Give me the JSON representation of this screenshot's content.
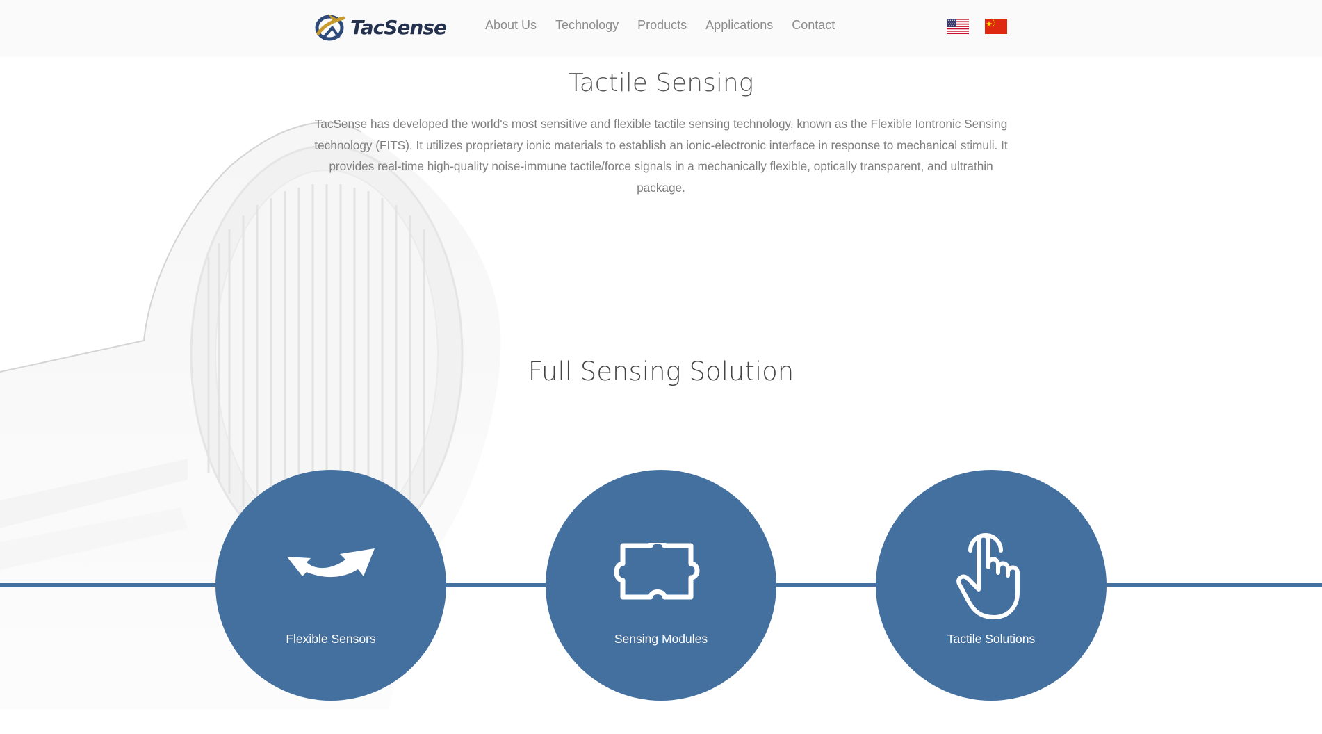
{
  "header": {
    "brand": "TacSense",
    "nav": [
      "About Us",
      "Technology",
      "Products",
      "Applications",
      "Contact"
    ],
    "languages": [
      {
        "icon": "us-flag-icon"
      },
      {
        "icon": "china-flag-icon"
      }
    ]
  },
  "intro": {
    "title": "Tactile Sensing",
    "body": "TacSense has developed the world's most sensitive and flexible tactile sensing technology, known as the Flexible Iontronic Sensing technology (FITS). It utilizes proprietary ionic materials to establish an ionic-electronic interface in response to mechanical stimuli. It provides real-time high-quality noise-immune tactile/force signals in a mechanically flexible, optically transparent, and ultrathin package."
  },
  "solutions": {
    "title": "Full Sensing Solution",
    "items": [
      {
        "label": "Flexible Sensors",
        "icon": "curved-arrows-icon"
      },
      {
        "label": "Sensing Modules",
        "icon": "puzzle-piece-icon"
      },
      {
        "label": "Tactile Solutions",
        "icon": "touch-hand-icon"
      }
    ]
  },
  "colors": {
    "accent": "#44709F",
    "nav_text": "#8C8C8C",
    "header_bg": "#FAFAFA"
  }
}
